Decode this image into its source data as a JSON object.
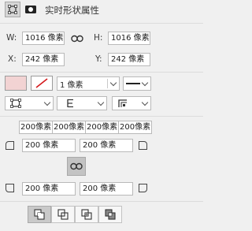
{
  "panel": {
    "title": "实时形状属性"
  },
  "transform": {
    "w_label": "W:",
    "w_value": "1016 像素",
    "h_label": "H:",
    "h_value": "1016 像素",
    "x_label": "X:",
    "x_value": "242 像素",
    "y_label": "Y:",
    "y_value": "242 像素"
  },
  "appearance": {
    "fill_color": "#f2d3d3",
    "stroke_width": "1 像素"
  },
  "corners": {
    "top_row": [
      "200像素",
      "200像素",
      "200像素",
      "200像素"
    ],
    "top_left": "200 像素",
    "top_right": "200 像素",
    "bottom_left": "200 像素",
    "bottom_right": "200 像素"
  },
  "icons": {
    "shape_tab": "square-shape-icon",
    "mask_tab": "mask-icon",
    "link_wh": "link-icon",
    "link_corners": "link-icon",
    "no_stroke": "no-stroke-icon",
    "stroke_style": "line-style-icon",
    "align": "align-icon",
    "caps": "cap-icon",
    "corners_type": "corner-type-icon"
  }
}
